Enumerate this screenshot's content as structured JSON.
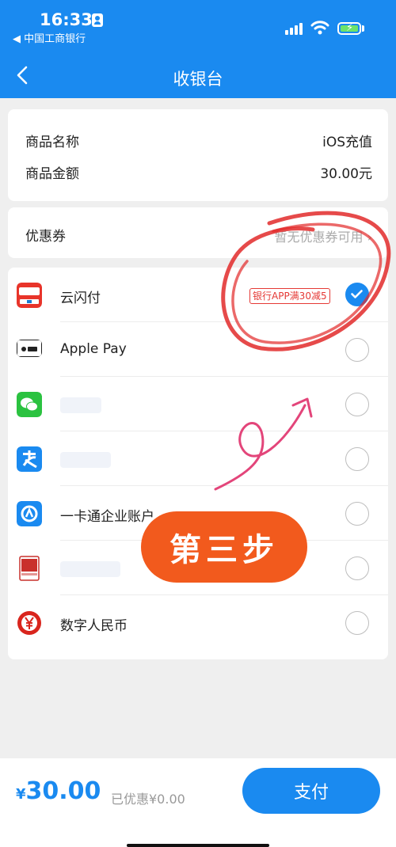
{
  "status_bar": {
    "time": "16:33",
    "back_app": "◀ 中国工商银行"
  },
  "nav": {
    "title": "收银台"
  },
  "product": {
    "name_label": "商品名称",
    "name_value": "iOS充值",
    "amount_label": "商品金额",
    "amount_value": "30.00元"
  },
  "coupon": {
    "label": "优惠券",
    "value": "暂无优惠券可用"
  },
  "payment_methods": [
    {
      "label": "云闪付",
      "icon": "unionpay-quickpass-icon",
      "promo": "银行APP满30减5",
      "selected": true
    },
    {
      "label": "Apple Pay",
      "icon": "apple-pay-icon",
      "selected": false
    },
    {
      "label": "",
      "icon": "wechat-pay-icon",
      "selected": false
    },
    {
      "label": "",
      "icon": "alipay-icon",
      "selected": false
    },
    {
      "label": "一卡通企业账户",
      "icon": "yikatong-icon",
      "selected": false
    },
    {
      "label": "",
      "icon": "jd-pay-icon",
      "selected": false
    },
    {
      "label": "数字人民币",
      "icon": "digital-rmb-icon",
      "selected": false
    }
  ],
  "overlay": {
    "step_text": "第三步"
  },
  "footer": {
    "currency": "¥",
    "total": "30.00",
    "discount": "已优惠¥0.00",
    "pay_button": "支付"
  },
  "colors": {
    "brand": "#1a8af0",
    "promo_red": "#e53935",
    "stamp_orange": "#f25a1d"
  }
}
